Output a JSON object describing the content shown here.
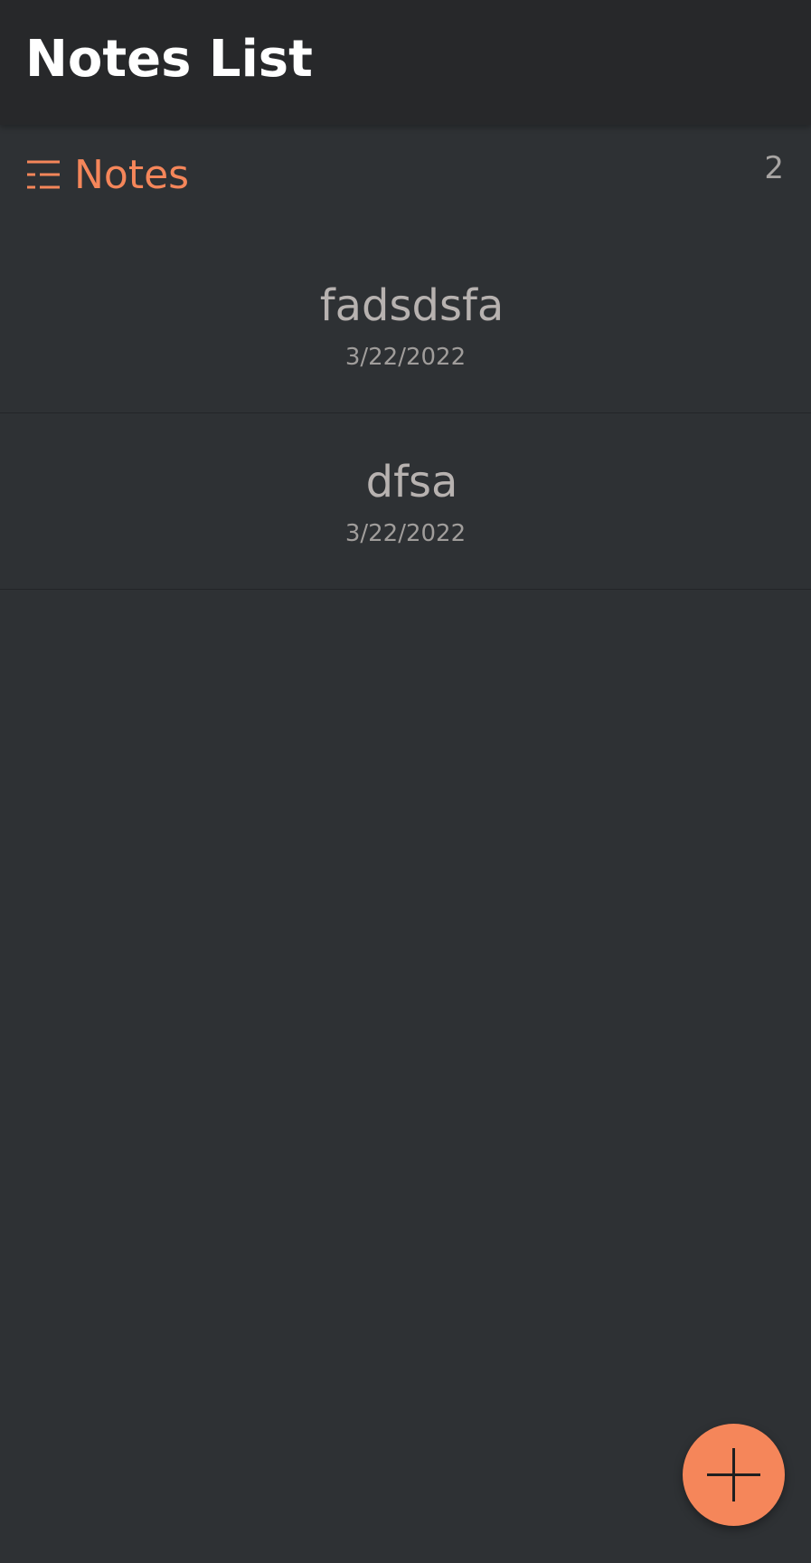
{
  "app_bar": {
    "title": "Notes List"
  },
  "section": {
    "icon": "list-icon",
    "label": "Notes",
    "count": "2"
  },
  "notes": [
    {
      "title": "fadsdsfa",
      "date": "3/22/2022"
    },
    {
      "title": "dfsa",
      "date": "3/22/2022"
    }
  ],
  "fab": {
    "icon": "plus-icon"
  },
  "colors": {
    "accent": "#f5865a",
    "background": "#2e3134",
    "app_bar": "#27282a",
    "title_text": "#ffffff",
    "note_title_text": "#b7b2b0",
    "secondary_text": "#a09d9b"
  }
}
